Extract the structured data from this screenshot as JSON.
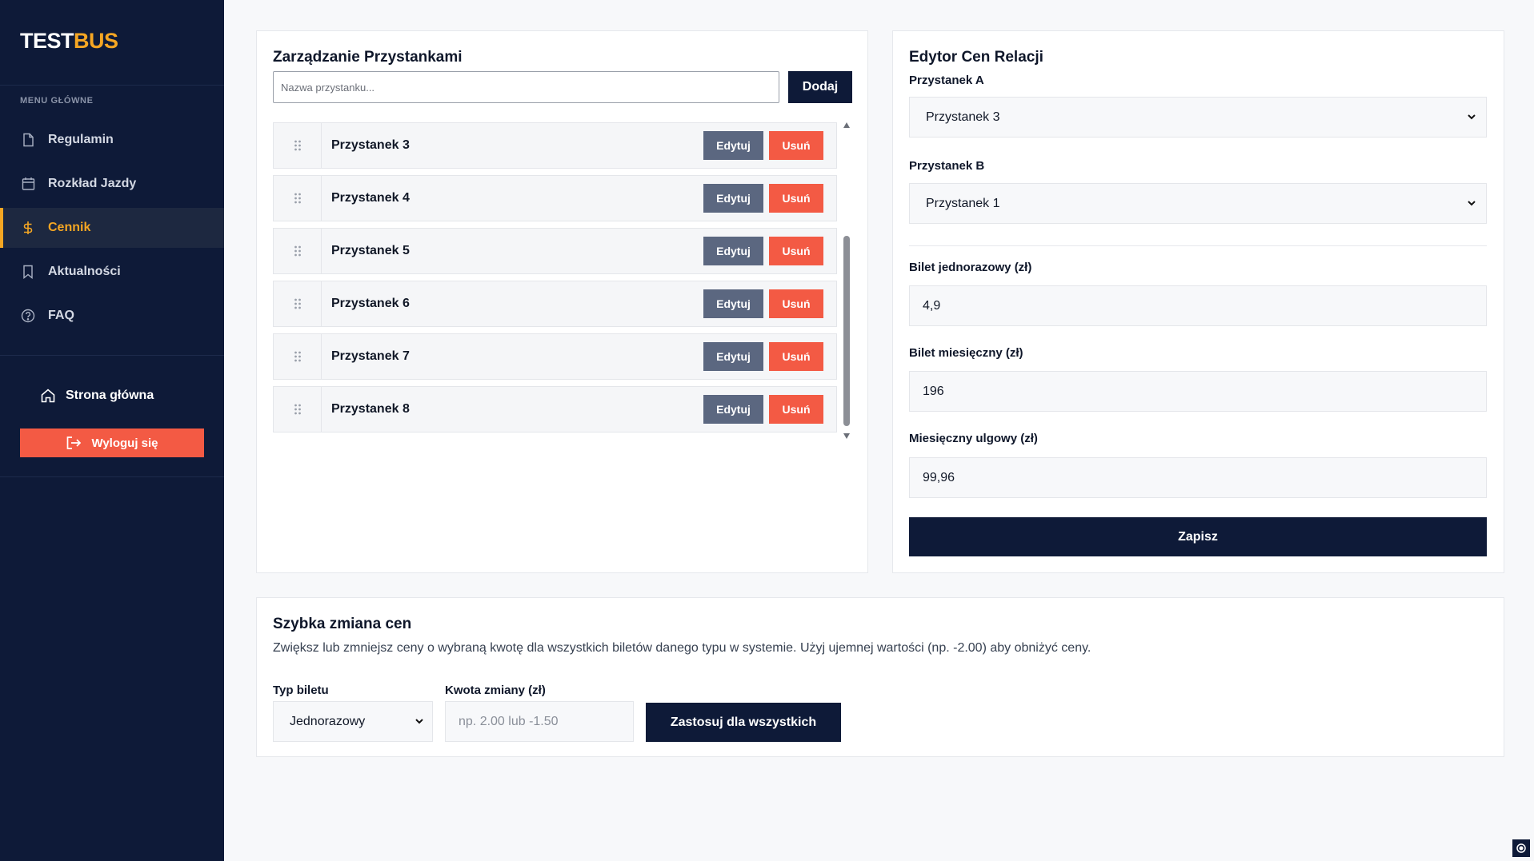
{
  "brand": {
    "part1": "TEST",
    "part2": "BUS"
  },
  "sidebar": {
    "menu_heading": "MENU GŁÓWNE",
    "items": [
      {
        "label": "Regulamin",
        "icon": "document-icon"
      },
      {
        "label": "Rozkład Jazdy",
        "icon": "calendar-icon"
      },
      {
        "label": "Cennik",
        "icon": "dollar-icon",
        "active": true
      },
      {
        "label": "Aktualności",
        "icon": "bookmark-icon"
      },
      {
        "label": "FAQ",
        "icon": "question-circle-icon"
      }
    ],
    "home_label": "Strona główna",
    "logout_label": "Wyloguj się"
  },
  "stops": {
    "title": "Zarządzanie Przystankami",
    "input_placeholder": "Nazwa przystanku...",
    "add_label": "Dodaj",
    "edit_label": "Edytuj",
    "delete_label": "Usuń",
    "items": [
      {
        "name": "Przystanek 3"
      },
      {
        "name": "Przystanek 4"
      },
      {
        "name": "Przystanek 5"
      },
      {
        "name": "Przystanek 6"
      },
      {
        "name": "Przystanek 7"
      },
      {
        "name": "Przystanek 8"
      }
    ]
  },
  "editor": {
    "title": "Edytor Cen Relacji",
    "stop_a_label": "Przystanek A",
    "stop_a_value": "Przystanek 3",
    "stop_b_label": "Przystanek B",
    "stop_b_value": "Przystanek 1",
    "single_label": "Bilet jednorazowy (zł)",
    "single_value": "4,9",
    "monthly_label": "Bilet miesięczny (zł)",
    "monthly_value": "196",
    "monthly_reduced_label": "Miesięczny ulgowy (zł)",
    "monthly_reduced_value": "99,96",
    "save_label": "Zapisz"
  },
  "quick": {
    "title": "Szybka zmiana cen",
    "description": "Zwiększ lub zmniejsz ceny o wybraną kwotę dla wszystkich biletów danego typu w systemie. Użyj ujemnej wartości (np. -2.00) aby obniżyć ceny.",
    "type_label": "Typ biletu",
    "type_value": "Jednorazowy",
    "amount_label": "Kwota zmiany (zł)",
    "amount_placeholder": "np. 2.00 lub -1.50",
    "apply_label": "Zastosuj dla wszystkich"
  },
  "colors": {
    "sidebar_bg": "#0e1a38",
    "accent": "#f5a623",
    "danger": "#f35a44",
    "edit": "#5b6780"
  }
}
